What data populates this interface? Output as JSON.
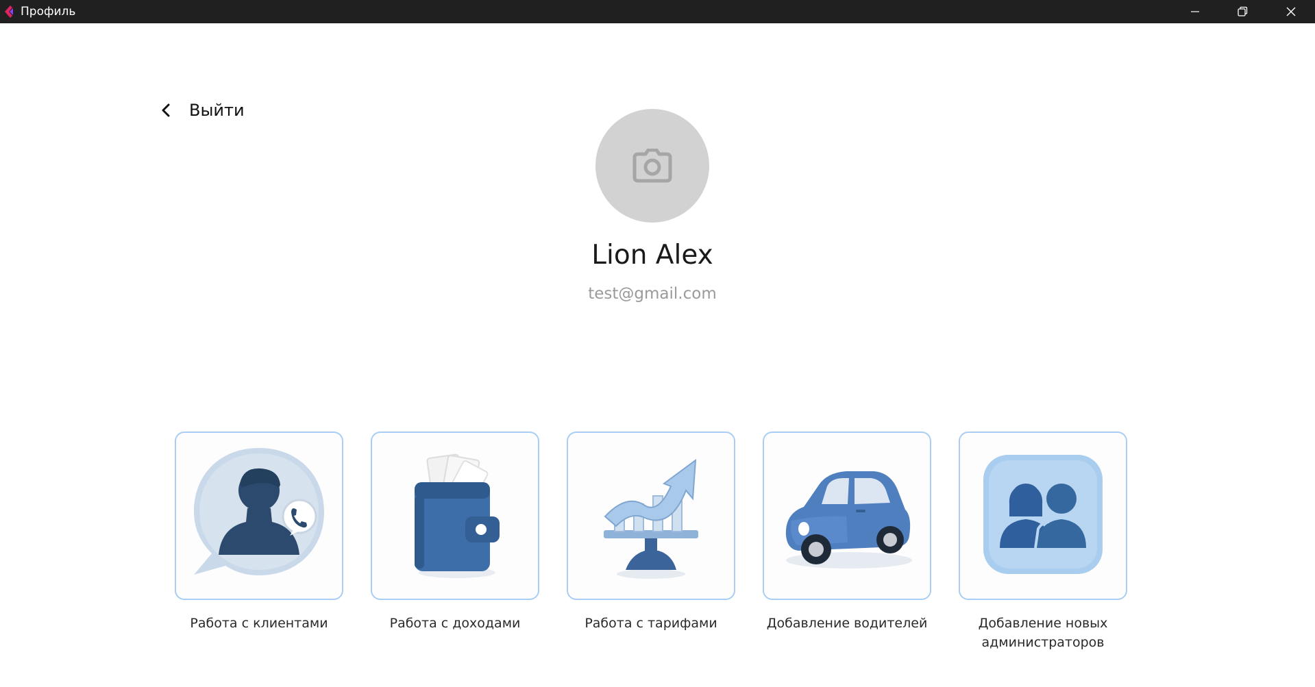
{
  "window": {
    "title": "Профиль",
    "app_icon": "app-logo-icon",
    "controls": [
      "minimize-icon",
      "restore-icon",
      "close-icon"
    ]
  },
  "nav": {
    "back_label": "Выйти",
    "back_icon": "chevron-left-icon"
  },
  "profile": {
    "avatar_icon": "camera-icon",
    "name": "Lion Alex",
    "email": "test@gmail.com"
  },
  "menu": {
    "items": [
      {
        "label": "Работа с клиентами",
        "icon": "customer-support-icon"
      },
      {
        "label": "Работа с доходами",
        "icon": "wallet-icon"
      },
      {
        "label": "Работа с тарифами",
        "icon": "growth-chart-icon"
      },
      {
        "label": "Добавление водителей",
        "icon": "car-icon"
      },
      {
        "label": "Добавление новых администраторов",
        "icon": "users-icon"
      }
    ]
  },
  "colors": {
    "titlebar": "#202020",
    "card_border": "#a9cdf5",
    "avatar_bg": "#d2d2d2",
    "icon_blue": "#3f6fa8",
    "icon_navy": "#2c4a6e",
    "icon_light": "#a9c9ea"
  }
}
